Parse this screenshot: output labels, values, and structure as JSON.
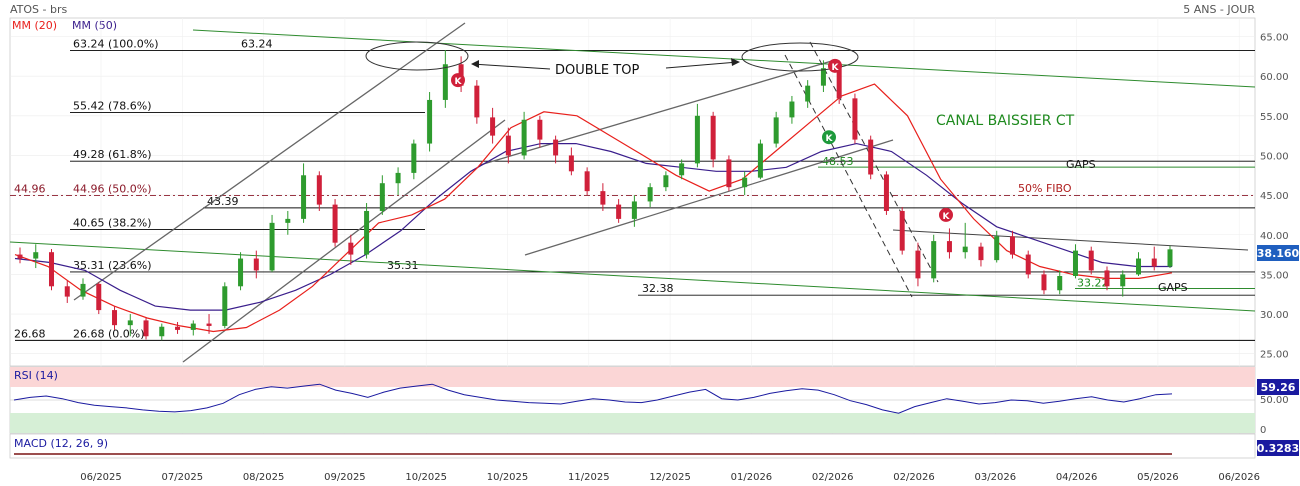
{
  "header": {
    "symbol": "ATOS - brs",
    "period": "5 ANS - JOUR",
    "ma20_label": "MM (20)",
    "ma50_label": "MM (50)"
  },
  "colors": {
    "candle_up": "#2e9b2e",
    "candle_down": "#d0203a",
    "ma20": "#e8201c",
    "ma50": "#3a1e8c",
    "fib": "#000000",
    "channel": "#2e8b2e",
    "wedge": "#555555",
    "price_badge": "#1f5fbf",
    "annotation_green": "#1e8a1e",
    "annotation_red": "#b02020",
    "rsi": "#1a1aa0",
    "macd": "#7a1414"
  },
  "chart_data": {
    "type": "candlestick",
    "title": "ATOS - brs",
    "subtitle": "5 ANS - JOUR",
    "y_ticks": [
      "65.00",
      "60.00",
      "55.00",
      "50.00",
      "45.00",
      "40.00",
      "35.00",
      "30.00",
      "25.00"
    ],
    "x_ticks": [
      "06/2025",
      "07/2025",
      "08/2025",
      "09/2025",
      "10/2025",
      "10/2025",
      "11/2025",
      "12/2025",
      "01/2026",
      "02/2026",
      "02/2026",
      "03/2026",
      "04/2026",
      "05/2026",
      "06/2026"
    ],
    "ylim": [
      23,
      67
    ],
    "last_price": "38.160",
    "series": [
      {
        "name": "MM (20)",
        "values": [
          37.5,
          36.0,
          33.0,
          31.0,
          29.5,
          28.5,
          27.8,
          28.3,
          30.5,
          33.5,
          37.5,
          41.5,
          42.5,
          44.5,
          48.5,
          53.5,
          55.5,
          55.0,
          52.5,
          50.0,
          47.5,
          45.5,
          47.0,
          50.5,
          54.0,
          57.5,
          59.0,
          55.0,
          47.0,
          42.0,
          38.0,
          36.0,
          35.0,
          34.5,
          34.5,
          35.2
        ]
      },
      {
        "name": "MM (50)",
        "values": [
          37.0,
          36.5,
          35.5,
          33.0,
          31.0,
          30.5,
          30.5,
          31.5,
          33.0,
          35.0,
          37.5,
          40.5,
          44.5,
          48.0,
          50.5,
          51.5,
          51.5,
          50.5,
          49.0,
          48.5,
          48.0,
          48.0,
          48.5,
          50.5,
          51.5,
          50.5,
          47.5,
          44.0,
          41.0,
          39.5,
          38.0,
          36.5,
          36.0,
          36.0
        ]
      }
    ],
    "candles": [
      {
        "o": 37.5,
        "h": 38.4,
        "l": 36.4,
        "c": 37.0
      },
      {
        "o": 37.0,
        "h": 38.8,
        "l": 35.8,
        "c": 37.8
      },
      {
        "o": 37.8,
        "h": 38.2,
        "l": 33.0,
        "c": 33.5
      },
      {
        "o": 33.5,
        "h": 34.2,
        "l": 31.4,
        "c": 32.2
      },
      {
        "o": 32.2,
        "h": 34.5,
        "l": 31.8,
        "c": 33.8
      },
      {
        "o": 33.8,
        "h": 34.0,
        "l": 30.0,
        "c": 30.5
      },
      {
        "o": 30.5,
        "h": 31.0,
        "l": 28.0,
        "c": 28.6
      },
      {
        "o": 28.6,
        "h": 30.0,
        "l": 27.2,
        "c": 29.2
      },
      {
        "o": 29.2,
        "h": 29.5,
        "l": 26.8,
        "c": 27.2
      },
      {
        "o": 27.2,
        "h": 28.8,
        "l": 26.7,
        "c": 28.4
      },
      {
        "o": 28.4,
        "h": 29.0,
        "l": 27.5,
        "c": 28.0
      },
      {
        "o": 28.0,
        "h": 29.2,
        "l": 27.3,
        "c": 28.8
      },
      {
        "o": 28.8,
        "h": 30.0,
        "l": 27.5,
        "c": 28.5
      },
      {
        "o": 28.5,
        "h": 34.0,
        "l": 28.2,
        "c": 33.5
      },
      {
        "o": 33.5,
        "h": 37.8,
        "l": 33.0,
        "c": 37.0
      },
      {
        "o": 37.0,
        "h": 38.0,
        "l": 34.5,
        "c": 35.5
      },
      {
        "o": 35.5,
        "h": 42.5,
        "l": 35.3,
        "c": 41.5
      },
      {
        "o": 41.5,
        "h": 43.0,
        "l": 40.0,
        "c": 42.0
      },
      {
        "o": 42.0,
        "h": 49.0,
        "l": 41.5,
        "c": 47.5
      },
      {
        "o": 47.5,
        "h": 48.0,
        "l": 43.0,
        "c": 43.8
      },
      {
        "o": 43.8,
        "h": 44.5,
        "l": 38.5,
        "c": 39.0
      },
      {
        "o": 39.0,
        "h": 40.0,
        "l": 36.2,
        "c": 37.5
      },
      {
        "o": 37.5,
        "h": 44.0,
        "l": 37.0,
        "c": 43.0
      },
      {
        "o": 43.0,
        "h": 47.5,
        "l": 42.5,
        "c": 46.5
      },
      {
        "o": 46.5,
        "h": 48.5,
        "l": 45.0,
        "c": 47.8
      },
      {
        "o": 47.8,
        "h": 52.0,
        "l": 47.0,
        "c": 51.5
      },
      {
        "o": 51.5,
        "h": 58.0,
        "l": 50.5,
        "c": 57.0
      },
      {
        "o": 57.0,
        "h": 63.3,
        "l": 56.0,
        "c": 61.5
      },
      {
        "o": 61.5,
        "h": 62.5,
        "l": 58.0,
        "c": 58.8
      },
      {
        "o": 58.8,
        "h": 59.5,
        "l": 54.0,
        "c": 54.8
      },
      {
        "o": 54.8,
        "h": 56.0,
        "l": 51.5,
        "c": 52.5
      },
      {
        "o": 52.5,
        "h": 53.5,
        "l": 49.0,
        "c": 50.0
      },
      {
        "o": 50.0,
        "h": 55.5,
        "l": 49.5,
        "c": 54.5
      },
      {
        "o": 54.5,
        "h": 55.0,
        "l": 51.0,
        "c": 52.0
      },
      {
        "o": 52.0,
        "h": 52.5,
        "l": 49.0,
        "c": 50.0
      },
      {
        "o": 50.0,
        "h": 51.0,
        "l": 47.5,
        "c": 48.0
      },
      {
        "o": 48.0,
        "h": 48.5,
        "l": 45.0,
        "c": 45.5
      },
      {
        "o": 45.5,
        "h": 46.5,
        "l": 43.0,
        "c": 43.8
      },
      {
        "o": 43.8,
        "h": 44.5,
        "l": 41.5,
        "c": 42.0
      },
      {
        "o": 42.0,
        "h": 45.0,
        "l": 41.0,
        "c": 44.2
      },
      {
        "o": 44.2,
        "h": 46.5,
        "l": 43.5,
        "c": 46.0
      },
      {
        "o": 46.0,
        "h": 48.0,
        "l": 45.5,
        "c": 47.5
      },
      {
        "o": 47.5,
        "h": 49.5,
        "l": 47.0,
        "c": 49.0
      },
      {
        "o": 49.0,
        "h": 56.5,
        "l": 48.5,
        "c": 55.0
      },
      {
        "o": 55.0,
        "h": 55.5,
        "l": 48.5,
        "c": 49.5
      },
      {
        "o": 49.5,
        "h": 50.0,
        "l": 45.5,
        "c": 46.0
      },
      {
        "o": 46.0,
        "h": 48.0,
        "l": 45.0,
        "c": 47.2
      },
      {
        "o": 47.2,
        "h": 52.0,
        "l": 47.0,
        "c": 51.5
      },
      {
        "o": 51.5,
        "h": 55.5,
        "l": 51.0,
        "c": 54.8
      },
      {
        "o": 54.8,
        "h": 57.5,
        "l": 54.0,
        "c": 56.8
      },
      {
        "o": 56.8,
        "h": 59.5,
        "l": 56.0,
        "c": 58.8
      },
      {
        "o": 58.8,
        "h": 62.0,
        "l": 58.0,
        "c": 61.0
      },
      {
        "o": 61.0,
        "h": 62.0,
        "l": 56.5,
        "c": 57.2
      },
      {
        "o": 57.2,
        "h": 57.8,
        "l": 51.5,
        "c": 52.0
      },
      {
        "o": 52.0,
        "h": 52.5,
        "l": 47.0,
        "c": 47.6
      },
      {
        "o": 47.6,
        "h": 48.0,
        "l": 42.5,
        "c": 43.0
      },
      {
        "o": 43.0,
        "h": 43.5,
        "l": 37.5,
        "c": 38.0
      },
      {
        "o": 38.0,
        "h": 39.0,
        "l": 33.5,
        "c": 34.5
      },
      {
        "o": 34.5,
        "h": 40.0,
        "l": 34.0,
        "c": 39.2
      },
      {
        "o": 39.2,
        "h": 40.8,
        "l": 37.0,
        "c": 37.8
      },
      {
        "o": 37.8,
        "h": 41.5,
        "l": 37.0,
        "c": 38.5
      },
      {
        "o": 38.5,
        "h": 39.0,
        "l": 36.0,
        "c": 36.8
      },
      {
        "o": 36.8,
        "h": 40.5,
        "l": 36.5,
        "c": 39.8
      },
      {
        "o": 39.8,
        "h": 40.5,
        "l": 37.0,
        "c": 37.5
      },
      {
        "o": 37.5,
        "h": 38.0,
        "l": 34.5,
        "c": 35.0
      },
      {
        "o": 35.0,
        "h": 35.5,
        "l": 32.5,
        "c": 33.0
      },
      {
        "o": 33.0,
        "h": 35.5,
        "l": 32.5,
        "c": 34.8
      },
      {
        "o": 34.8,
        "h": 38.8,
        "l": 34.5,
        "c": 38.0
      },
      {
        "o": 38.0,
        "h": 38.5,
        "l": 35.0,
        "c": 35.5
      },
      {
        "o": 35.5,
        "h": 36.0,
        "l": 33.0,
        "c": 33.5
      },
      {
        "o": 33.5,
        "h": 35.5,
        "l": 32.2,
        "c": 35.0
      },
      {
        "o": 35.0,
        "h": 37.8,
        "l": 34.8,
        "c": 37.0
      },
      {
        "o": 37.0,
        "h": 38.5,
        "l": 35.5,
        "c": 36.0
      },
      {
        "o": 36.0,
        "h": 38.6,
        "l": 35.8,
        "c": 38.16
      }
    ],
    "levels": [
      {
        "label": "63.24  (100.0%)",
        "value": 63.24,
        "extra": "63.24"
      },
      {
        "label": "55.42  (78.6%)",
        "value": 55.42
      },
      {
        "label": "49.28  (61.8%)",
        "value": 49.28
      },
      {
        "label": "44.96  (50.0%)",
        "value": 44.96,
        "left": "44.96",
        "dashed": true
      },
      {
        "label": "40.65  (38.2%)",
        "value": 40.65
      },
      {
        "label": "35.31  (23.6%)",
        "value": 35.31,
        "extra": "35.31"
      },
      {
        "label": "26.68  (0.0%)",
        "value": 26.68,
        "left": "26.68"
      }
    ],
    "extra_levels": [
      {
        "value": 43.39,
        "text": "43.39"
      },
      {
        "value": 32.38,
        "text": "32.38"
      },
      {
        "value": 48.53,
        "text": "48.53"
      },
      {
        "value": 33.22,
        "text": "33.22"
      }
    ],
    "annotations": {
      "double_top": "DOUBLE TOP",
      "canal": "CANAL BAISSIER CT",
      "gaps_upper": "GAPS",
      "gaps_lower": "GAPS",
      "fibo50": "50% FIBO",
      "signals": [
        {
          "letter": "K",
          "color": "#d0203a",
          "price": 59.5
        },
        {
          "letter": "K",
          "color": "#d0203a",
          "price": 61.3
        },
        {
          "letter": "K",
          "color": "#1e9a3c",
          "price": 52.3
        },
        {
          "letter": "K",
          "color": "#d0203a",
          "price": 42.5
        }
      ]
    },
    "rsi": {
      "label": "RSI (14)",
      "ticks": [
        "50.00",
        "0"
      ],
      "last": "59.26",
      "values": [
        50,
        54,
        56,
        52,
        46,
        42,
        40,
        38,
        35,
        33,
        32,
        34,
        38,
        45,
        58,
        66,
        70,
        68,
        71,
        74,
        65,
        60,
        54,
        62,
        68,
        71,
        74,
        65,
        58,
        54,
        50,
        48,
        46,
        45,
        44,
        48,
        52,
        50,
        47,
        46,
        50,
        56,
        62,
        66,
        52,
        50,
        54,
        60,
        64,
        67,
        65,
        58,
        49,
        43,
        35,
        30,
        40,
        46,
        52,
        48,
        44,
        46,
        50,
        49,
        45,
        48,
        52,
        55,
        50,
        47,
        52,
        58,
        59.26
      ]
    },
    "macd": {
      "label": "MACD (12, 26, 9)",
      "last": "0.3283"
    }
  }
}
